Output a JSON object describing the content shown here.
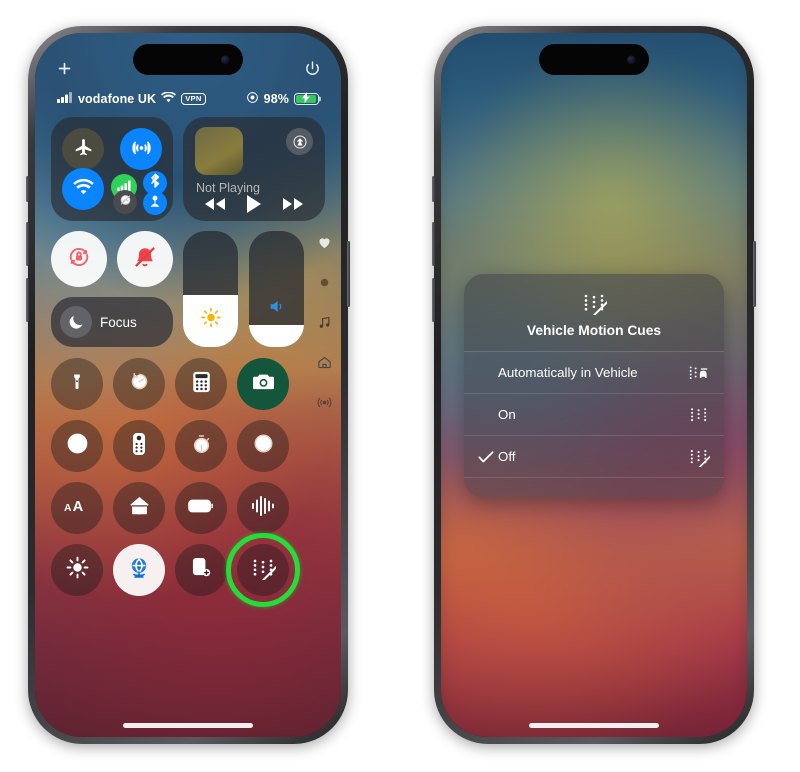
{
  "meta": {
    "scene": "iOS Control Center with Vehicle Motion Cues options menu"
  },
  "phone_left": {
    "top_controls": {
      "add_label": "+",
      "add_icon": "plus-icon",
      "power_icon": "power-icon"
    },
    "status_bar": {
      "signal_icon": "cellular-signal-icon",
      "carrier": "vodafone UK",
      "wifi_icon": "wifi-icon",
      "vpn_badge": "VPN",
      "orientation_lock_icon": "rotation-lock-indicator-icon",
      "battery_percent": "98%",
      "battery_icon": "battery-charging-icon",
      "battery_fill_color": "#35c759"
    },
    "connectivity_module": {
      "airplane": {
        "label": "Airplane Mode",
        "icon": "airplane-icon",
        "active": false,
        "color": "#4c4b40"
      },
      "cellular_data": {
        "label": "Cellular Data",
        "icon": "cellular-data-icon",
        "active": true,
        "color": "#0a84ff"
      },
      "wifi": {
        "label": "Wi-Fi",
        "icon": "wifi-icon",
        "active": true,
        "color": "#0a84ff"
      },
      "signal": {
        "label": "Signal Strength",
        "icon": "signal-bars-icon",
        "active": true,
        "color": "#30d158"
      },
      "bluetooth": {
        "label": "Bluetooth",
        "icon": "bluetooth-icon",
        "active": true,
        "color": "#0a84ff"
      },
      "airdrop": {
        "label": "AirDrop",
        "icon": "airdrop-off-icon",
        "active": false,
        "color": "#4b4b4f"
      },
      "hotspot": {
        "label": "Personal Hotspot",
        "icon": "personal-hotspot-icon",
        "active": true,
        "color": "#0a84ff"
      }
    },
    "media_module": {
      "now_playing": "Not Playing",
      "airplay_icon": "airplay-audio-icon",
      "artwork": "album-artwork-placeholder",
      "rewind_icon": "rewind-icon",
      "play_icon": "play-icon",
      "forward_icon": "fast-forward-icon"
    },
    "quick_toggles": {
      "rotation_lock": {
        "label": "Portrait Orientation Lock",
        "icon": "rotation-lock-icon",
        "active": true
      },
      "silent_mode": {
        "label": "Silent Mode",
        "icon": "bell-slash-icon",
        "active": true
      },
      "focus": {
        "label": "Focus",
        "icon": "moon-icon",
        "active": false
      }
    },
    "sliders": {
      "brightness": {
        "label": "Brightness",
        "icon": "brightness-icon",
        "value": 45
      },
      "volume": {
        "label": "Volume",
        "icon": "speaker-icon",
        "value": 19
      }
    },
    "side_rail": [
      {
        "label": "Health",
        "icon": "heart-icon"
      },
      {
        "label": "Indicator Dot",
        "icon": "dot-icon"
      },
      {
        "label": "Music",
        "icon": "music-note-icon"
      },
      {
        "label": "Home",
        "icon": "home-icon"
      },
      {
        "label": "Connectivity",
        "icon": "broadcast-icon"
      }
    ],
    "control_grid": [
      [
        {
          "label": "Flashlight",
          "icon": "flashlight-icon",
          "style": "dark"
        },
        {
          "label": "Timer",
          "icon": "timer-icon",
          "style": "dark"
        },
        {
          "label": "Calculator",
          "icon": "calculator-icon",
          "style": "dark"
        },
        {
          "label": "Camera",
          "icon": "camera-icon",
          "style": "green"
        }
      ],
      [
        {
          "label": "Accessibility Shortcuts",
          "icon": "accessibility-icon",
          "style": "dark"
        },
        {
          "label": "Apple TV Remote",
          "icon": "tv-remote-icon",
          "style": "dark"
        },
        {
          "label": "Stopwatch",
          "icon": "stopwatch-icon",
          "style": "dark"
        },
        {
          "label": "Screen Recording",
          "icon": "screen-record-icon",
          "style": "dark"
        }
      ],
      [
        {
          "label": "Text Size",
          "icon": "text-size-icon",
          "style": "dark"
        },
        {
          "label": "Home",
          "icon": "home-icon",
          "style": "dark"
        },
        {
          "label": "Low Power Mode",
          "icon": "low-power-battery-icon",
          "style": "dark"
        },
        {
          "label": "Voice Memos",
          "icon": "waveform-icon",
          "style": "dark"
        }
      ],
      [
        {
          "label": "Dark Mode",
          "icon": "sun-icon",
          "style": "dark"
        },
        {
          "label": "Private Relay",
          "icon": "globe-network-icon",
          "style": "white"
        },
        {
          "label": "Add Widget",
          "icon": "add-screen-icon",
          "style": "dark"
        },
        {
          "label": "Vehicle Motion Cues",
          "icon": "vehicle-motion-cues-off-icon",
          "style": "dark",
          "highlighted": true,
          "highlight_color": "#22dd3a"
        }
      ]
    ]
  },
  "phone_right": {
    "popup": {
      "header_icon": "vehicle-motion-cues-off-icon",
      "title": "Vehicle Motion Cues",
      "options": [
        {
          "label": "Automatically in Vehicle",
          "icon": "vehicle-motion-cues-auto-icon",
          "selected": false
        },
        {
          "label": "On",
          "icon": "vehicle-motion-cues-on-icon",
          "selected": false
        },
        {
          "label": "Off",
          "icon": "vehicle-motion-cues-off-icon",
          "selected": true
        }
      ],
      "check_icon": "checkmark-icon"
    }
  }
}
